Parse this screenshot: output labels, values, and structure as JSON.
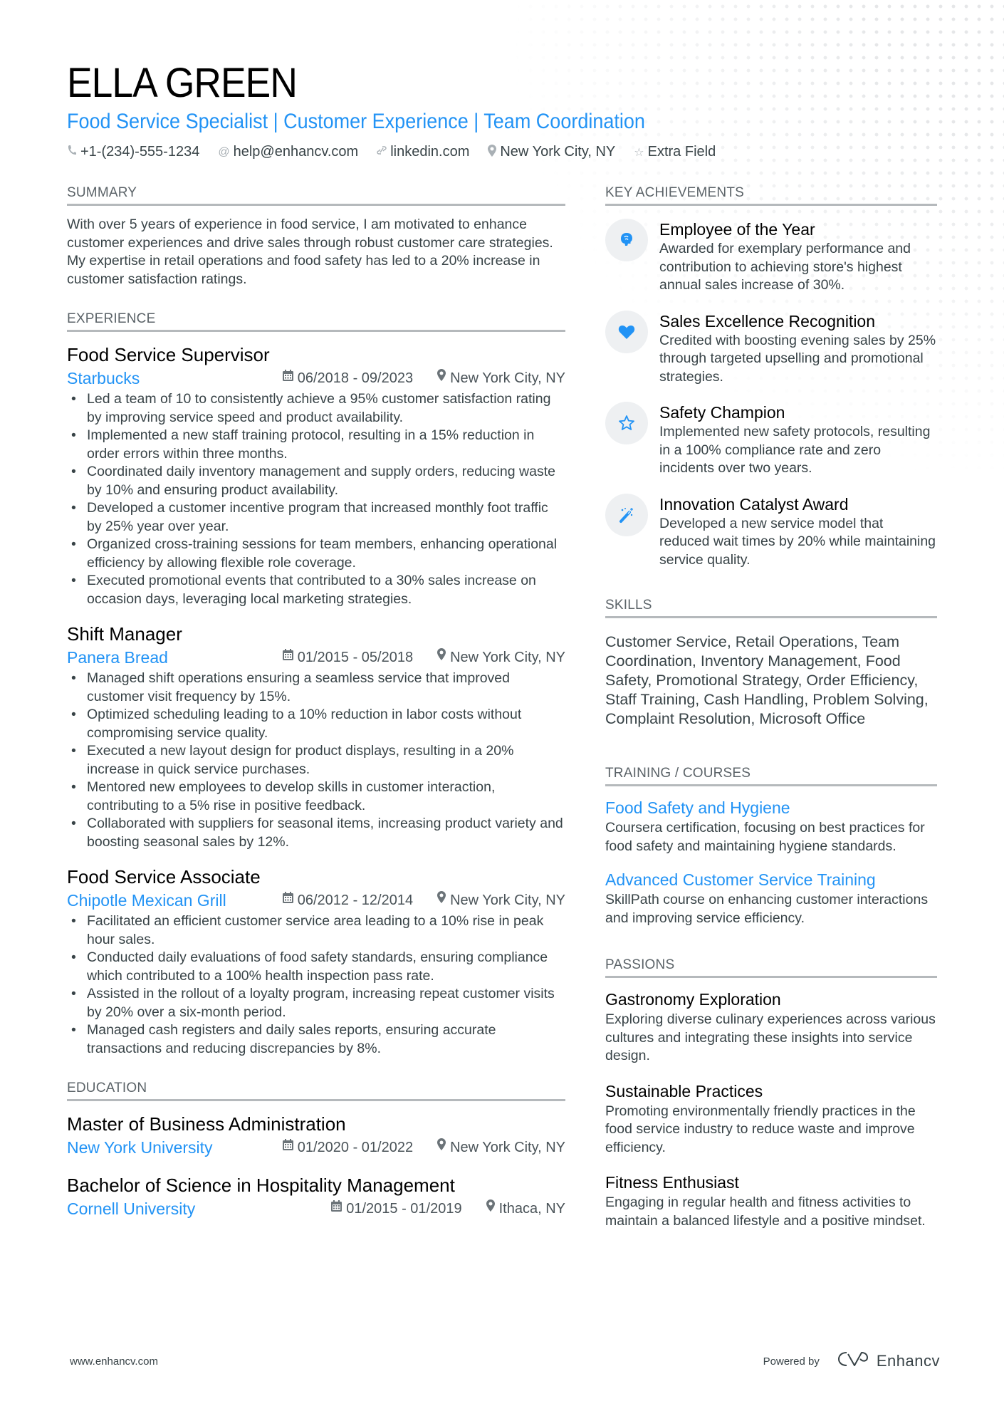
{
  "header": {
    "name": "ELLA GREEN",
    "title": "Food Service Specialist | Customer Experience | Team Coordination",
    "contacts": [
      {
        "icon": "phone-icon",
        "text": "+1-(234)-555-1234"
      },
      {
        "icon": "at-icon",
        "text": "help@enhancv.com"
      },
      {
        "icon": "link-icon",
        "text": "linkedin.com"
      },
      {
        "icon": "location-icon",
        "text": "New York City, NY"
      },
      {
        "icon": "star-icon",
        "text": "Extra Field"
      }
    ]
  },
  "summary": {
    "heading": "SUMMARY",
    "text": "With over 5 years of experience in food service, I am motivated to enhance customer experiences and drive sales through robust customer care strategies. My expertise in retail operations and food safety has led to a 20% increase in customer satisfaction ratings."
  },
  "experience": {
    "heading": "EXPERIENCE",
    "jobs": [
      {
        "title": "Food Service Supervisor",
        "company": "Starbucks",
        "dates": "06/2018 - 09/2023",
        "location": "New York City, NY",
        "bullets": [
          "Led a team of 10 to consistently achieve a 95% customer satisfaction rating by improving service speed and product availability.",
          "Implemented a new staff training protocol, resulting in a 15% reduction in order errors within three months.",
          "Coordinated daily inventory management and supply orders, reducing waste by 10% and ensuring product availability.",
          "Developed a customer incentive program that increased monthly foot traffic by 25% year over year.",
          "Organized cross-training sessions for team members, enhancing operational efficiency by allowing flexible role coverage.",
          "Executed promotional events that contributed to a 30% sales increase on occasion days, leveraging local marketing strategies."
        ]
      },
      {
        "title": "Shift Manager",
        "company": "Panera Bread",
        "dates": "01/2015 - 05/2018",
        "location": "New York City, NY",
        "bullets": [
          "Managed shift operations ensuring a seamless service that improved customer visit frequency by 15%.",
          "Optimized scheduling leading to a 10% reduction in labor costs without compromising service quality.",
          "Executed a new layout design for product displays, resulting in a 20% increase in quick service purchases.",
          "Mentored new employees to develop skills in customer interaction, contributing to a 5% rise in positive feedback.",
          "Collaborated with suppliers for seasonal items, increasing product variety and boosting seasonal sales by 12%."
        ]
      },
      {
        "title": "Food Service Associate",
        "company": "Chipotle Mexican Grill",
        "dates": "06/2012 - 12/2014",
        "location": "New York City, NY",
        "bullets": [
          "Facilitated an efficient customer service area leading to a 10% rise in peak hour sales.",
          "Conducted daily evaluations of food safety standards, ensuring compliance which contributed to a 100% health inspection pass rate.",
          "Assisted in the rollout of a loyalty program, increasing repeat customer visits by 20% over a six-month period.",
          "Managed cash registers and daily sales reports, ensuring accurate transactions and reducing discrepancies by 8%."
        ]
      }
    ]
  },
  "education": {
    "heading": "EDUCATION",
    "items": [
      {
        "degree": "Master of Business Administration",
        "school": "New York University",
        "dates": "01/2020 - 01/2022",
        "location": "New York City, NY"
      },
      {
        "degree": "Bachelor of Science in Hospitality Management",
        "school": "Cornell University",
        "dates": "01/2015 - 01/2019",
        "location": "Ithaca, NY"
      }
    ]
  },
  "achievements": {
    "heading": "KEY ACHIEVEMENTS",
    "items": [
      {
        "icon": "brain-icon",
        "title": "Employee of the Year",
        "desc": "Awarded for exemplary performance and contribution to achieving store's highest annual sales increase of 30%."
      },
      {
        "icon": "heart-icon",
        "title": "Sales Excellence Recognition",
        "desc": "Credited with boosting evening sales by 25% through targeted upselling and promotional strategies."
      },
      {
        "icon": "star-icon",
        "title": "Safety Champion",
        "desc": "Implemented new safety protocols, resulting in a 100% compliance rate and zero incidents over two years."
      },
      {
        "icon": "magic-wand-icon",
        "title": "Innovation Catalyst Award",
        "desc": "Developed a new service model that reduced wait times by 20% while maintaining service quality."
      }
    ]
  },
  "skills": {
    "heading": "SKILLS",
    "text": "Customer Service, Retail Operations, Team Coordination, Inventory Management, Food Safety, Promotional Strategy, Order Efficiency, Staff Training, Cash Handling, Problem Solving, Complaint Resolution, Microsoft Office"
  },
  "training": {
    "heading": "TRAINING / COURSES",
    "items": [
      {
        "title": "Food Safety and Hygiene",
        "desc": "Coursera certification, focusing on best practices for food safety and maintaining hygiene standards."
      },
      {
        "title": "Advanced Customer Service Training",
        "desc": "SkillPath course on enhancing customer interactions and improving service efficiency."
      }
    ]
  },
  "passions": {
    "heading": "PASSIONS",
    "items": [
      {
        "title": "Gastronomy Exploration",
        "desc": "Exploring diverse culinary experiences across various cultures and integrating these insights into service design."
      },
      {
        "title": "Sustainable Practices",
        "desc": "Promoting environmentally friendly practices in the food service industry to reduce waste and improve efficiency."
      },
      {
        "title": "Fitness Enthusiast",
        "desc": "Engaging in regular health and fitness activities to maintain a balanced lifestyle and a positive mindset."
      }
    ]
  },
  "footer": {
    "website": "www.enhancv.com",
    "powered_by": "Powered by",
    "brand": "Enhancv"
  },
  "colors": {
    "accent": "#2293f5",
    "text": "#384347",
    "rule": "#b5b9bc"
  }
}
